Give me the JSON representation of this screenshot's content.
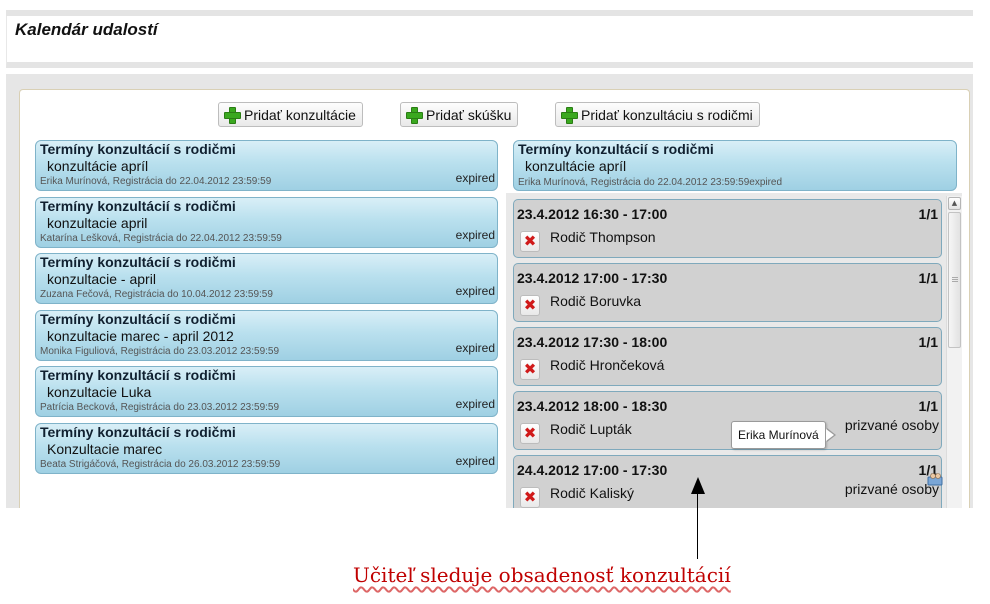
{
  "page_title": "Kalendár udalostí",
  "toolbar": {
    "add_consultation": "Pridať konzultácie",
    "add_exam": "Pridať skúšku",
    "add_parent_consultation": "Pridať konzultáciu s rodičmi"
  },
  "events": [
    {
      "title": "Termíny konzultácií s rodičmi",
      "name": "konzultácie apríl",
      "meta": "Erika Murínová, Registrácia do 22.04.2012 23:59:59",
      "status": "expired"
    },
    {
      "title": "Termíny konzultácií s rodičmi",
      "name": "konzultacie april",
      "meta": "Katarína Lešková, Registrácia do 22.04.2012 23:59:59",
      "status": "expired"
    },
    {
      "title": "Termíny konzultácií s rodičmi",
      "name": "konzultacie - april",
      "meta": "Zuzana Fečová, Registrácia do 10.04.2012 23:59:59",
      "status": "expired"
    },
    {
      "title": "Termíny konzultácií s rodičmi",
      "name": "konzultacie marec - april 2012",
      "meta": "Monika Figuliová, Registrácia do 23.03.2012 23:59:59",
      "status": "expired"
    },
    {
      "title": "Termíny konzultácií s rodičmi",
      "name": "konzultacie Luka",
      "meta": "Patrícia Becková, Registrácia do 23.03.2012 23:59:59",
      "status": "expired"
    },
    {
      "title": "Termíny konzultácií s rodičmi",
      "name": "Konzultacie marec",
      "meta": "Beata Strigáčová, Registrácia do 26.03.2012 23:59:59",
      "status": "expired"
    }
  ],
  "detail": {
    "title": "Termíny konzultácií s rodičmi",
    "name": "konzultácie apríl",
    "meta": "Erika Murínová, Registrácia do 22.04.2012 23:59:59expired"
  },
  "slots": [
    {
      "time": "23.4.2012 16:30 - 17:00",
      "count": "1/1",
      "parent": "Rodič Thompson",
      "invited": ""
    },
    {
      "time": "23.4.2012 17:00 - 17:30",
      "count": "1/1",
      "parent": "Rodič Boruvka",
      "invited": ""
    },
    {
      "time": "23.4.2012 17:30 - 18:00",
      "count": "1/1",
      "parent": "Rodič Hrončeková",
      "invited": ""
    },
    {
      "time": "23.4.2012 18:00 - 18:30",
      "count": "1/1",
      "parent": "Rodič Lupták",
      "invited": "prizvané osoby"
    },
    {
      "time": "24.4.2012 17:00 - 17:30",
      "count": "1/1",
      "parent": "Rodič Kaliský",
      "invited": "prizvané osoby"
    }
  ],
  "tooltip": "Erika Murínová",
  "caption": "Učiteľ sleduje obsadenosť konzultácií",
  "icons": {
    "add": "plus-icon",
    "remove": "x-icon",
    "invited_people": "people-icon",
    "scroll_up": "chevron-up-icon"
  },
  "colors": {
    "card_gradient_top": "#d9eff7",
    "card_gradient_bottom": "#9fd0e3",
    "card_border": "#7fb3c9",
    "slot_bg": "#d1d1d1",
    "remove_icon": "#d01a1a",
    "add_icon": "#3aa81f",
    "caption": "#c00000"
  }
}
